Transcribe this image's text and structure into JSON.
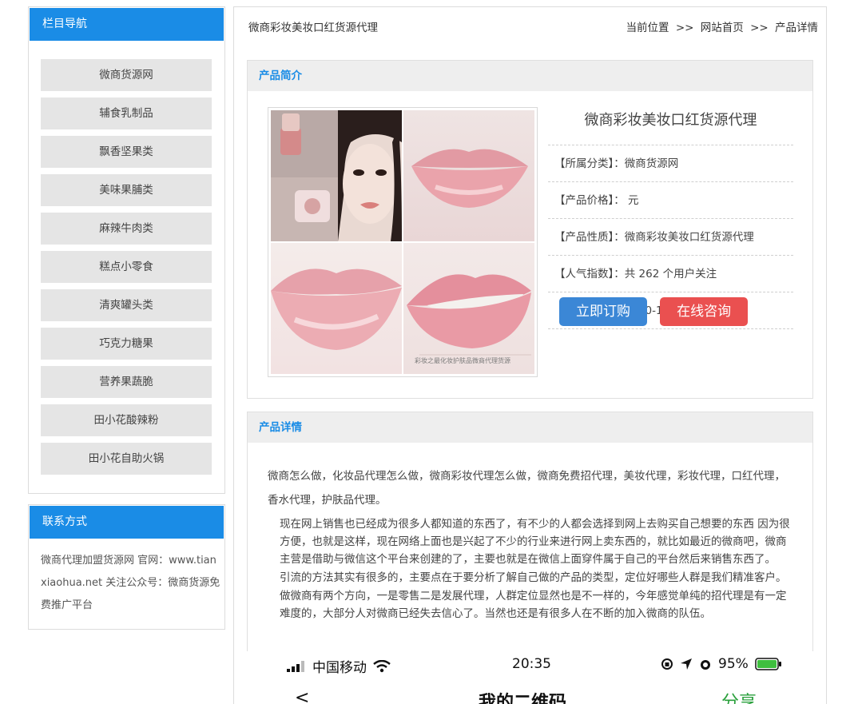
{
  "sidebar": {
    "title": "栏目导航",
    "items": [
      {
        "label": "微商货源网"
      },
      {
        "label": "辅食乳制品"
      },
      {
        "label": "飘香坚果类"
      },
      {
        "label": "美味果脯类"
      },
      {
        "label": "麻辣牛肉类"
      },
      {
        "label": "糕点小零食"
      },
      {
        "label": "清爽罐头类"
      },
      {
        "label": "巧克力糖果"
      },
      {
        "label": "营养果蔬脆"
      },
      {
        "label": "田小花酸辣粉"
      },
      {
        "label": "田小花自助火锅"
      }
    ]
  },
  "contact": {
    "title": "联系方式",
    "text": "微商代理加盟货源网 官网：www.tianxiaohua.net 关注公众号：微商货源免费推广平台"
  },
  "header": {
    "heading": "微商彩妆美妆口红货源代理",
    "breadcrumb_prefix": "当前位置",
    "separator": ">>",
    "home": "网站首页",
    "current": "产品详情"
  },
  "intro": {
    "title": "产品简介",
    "product_name": "微商彩妆美妆口红货源代理",
    "category": "【所属分类】：微商货源网",
    "price": "【产品价格】： 元",
    "nature": "【产品性质】：微商彩妆美妆口红货源代理",
    "popularity": "【人气指数】：共 262 个用户关注",
    "updated": "【更新日期】：2020-12-11 19:06:23",
    "order_button": "立即订购",
    "consult_button": "在线咨询",
    "photo_watermark": "彩妆之最化妆护肤品微商代理货源"
  },
  "detail": {
    "title": "产品详情",
    "lead": "微商怎么做，化妆品代理怎么做，微商彩妆代理怎么做，微商免费招代理，美妆代理，彩妆代理，口红代理，香水代理，护肤品代理。",
    "paragraphs": [
      "现在网上销售也已经成为很多人都知道的东西了，有不少的人都会选择到网上去购买自己想要的东西 因为很方便，也就是这样，现在网络上面也是兴起了不少的行业来进行网上卖东西的，就比如最近的微商吧，微商主营是借助与微信这个平台来创建的了，主要也就是在微信上面穿件属于自己的平台然后来销售东西了。",
      "引流的方法其实有很多的，主要点在于要分析了解自己做的产品的类型，定位好哪些人群是我们精准客户。",
      "做微商有两个方向，一是零售二是发展代理，人群定位显然也是不一样的，今年感觉单纯的招代理是有一定难度的，大部分人对微商已经失去信心了。当然也还是有很多人在不断的加入微商的队伍。"
    ]
  },
  "phone": {
    "carrier": "中国移动",
    "time": "20:35",
    "battery": "95%",
    "nav_back": "<",
    "nav_title": "我的二维码",
    "nav_share": "分享"
  }
}
